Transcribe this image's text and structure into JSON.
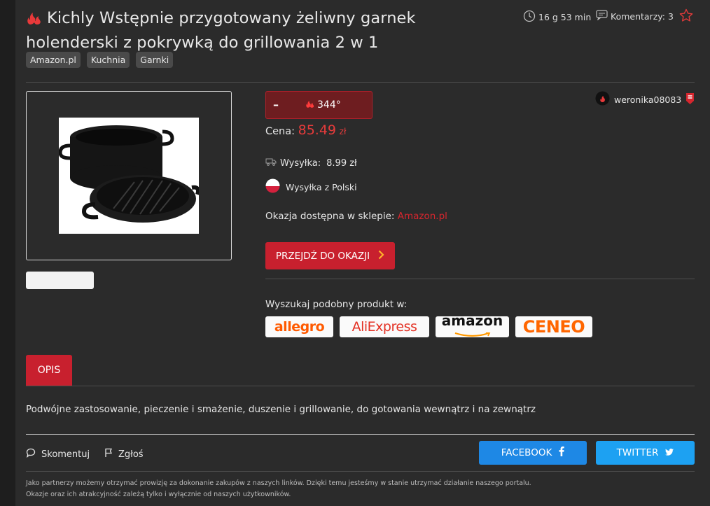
{
  "deal": {
    "title": "Kichly Wstępnie przygotowany żeliwny garnek holenderski z pokrywką do grillowania 2 w 1",
    "tags": [
      "Amazon.pl",
      "Kuchnia",
      "Garnki"
    ],
    "time_ago": "16 g 53 min",
    "comments_label": "Komentarzy: 3",
    "temperature": "344°",
    "minus_label": "–",
    "price_label": "Cena:",
    "price_value": "85.49",
    "price_currency": "zł",
    "shipping_label": "Wysyłka:",
    "shipping_value": "8.99 zł",
    "ships_from": "Wysyłka z Polski",
    "store_label": "Okazja dostępna w sklepie:",
    "store_name": "Amazon.pl",
    "cta_label": "PRZEJDŹ DO OKAZJI",
    "author": "weronika08083"
  },
  "search": {
    "label": "Wyszukaj podobny produkt w:",
    "shops": [
      "allegro",
      "AliExpress",
      "amazon",
      "CENEO"
    ]
  },
  "tabs": {
    "description": "OPIS"
  },
  "description": "Podwójne zastosowanie, pieczenie i smażenie, duszenie i grillowanie, do gotowania wewnątrz i na zewnątrz",
  "actions": {
    "comment": "Skomentuj",
    "report": "Zgłoś",
    "facebook": "FACEBOOK",
    "twitter": "TWITTER"
  },
  "footer": {
    "line1": "Jako partnerzy możemy otrzymać prowizję za dokonanie zakupów z naszych linków. Dzięki temu jesteśmy w stanie utrzymać działanie naszego portalu.",
    "line2": "Okazje oraz ich atrakcyjność zależą tylko i wyłącznie od naszych użytkowników."
  },
  "colors": {
    "accent": "#c8202e",
    "price": "#e63b3b",
    "facebook": "#1e88e5",
    "twitter": "#1da1f2",
    "background": "#2b2b2b"
  }
}
